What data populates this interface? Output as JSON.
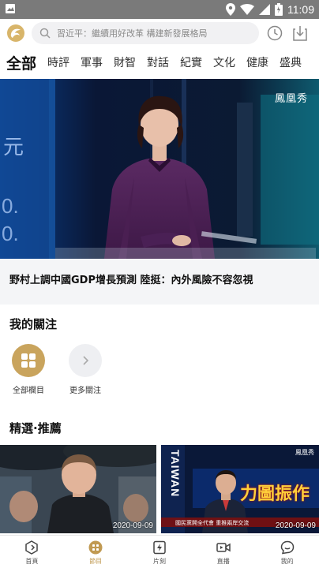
{
  "status_bar": {
    "time": "11:09"
  },
  "header": {
    "search_placeholder": "習近平：繼續用好改革 構建新發展格局"
  },
  "tabs": [
    "全部",
    "時評",
    "軍事",
    "財智",
    "對話",
    "紀實",
    "文化",
    "健康",
    "盛典"
  ],
  "hero": {
    "watermark": "鳳凰秀",
    "headline": "野村上調中國GDP增長預測 陸挺：內外風險不容忽視"
  },
  "my_follows": {
    "title": "我的關注",
    "items": [
      {
        "label": "全部欄目",
        "icon": "grid-icon"
      },
      {
        "label": "更多關注",
        "icon": "chevron-right-icon"
      }
    ]
  },
  "recommend": {
    "title": "精選·推薦",
    "cards": [
      {
        "date": "2020-09-09"
      },
      {
        "date": "2020-09-09",
        "side_text": "TAIWAN",
        "banner": "力圖振作",
        "watermark": "鳳凰秀",
        "ticker": "國民黨開全代會 重推兩岸交流"
      }
    ]
  },
  "bottom_nav": [
    {
      "label": "首頁",
      "icon": "home-icon"
    },
    {
      "label": "節目",
      "icon": "program-icon",
      "active": true
    },
    {
      "label": "片刻",
      "icon": "lightning-icon"
    },
    {
      "label": "直播",
      "icon": "live-video-icon"
    },
    {
      "label": "我的",
      "icon": "profile-icon"
    }
  ],
  "colors": {
    "accent": "#c19a52",
    "status_bar": "#7a7a7a",
    "section_bg": "#f4f5f7"
  }
}
